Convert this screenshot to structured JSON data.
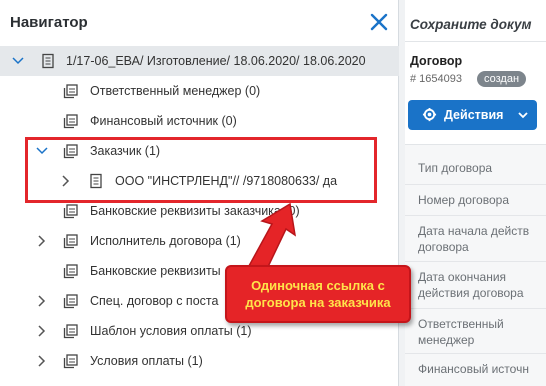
{
  "navigator": {
    "title": "Навигатор",
    "tree": [
      {
        "label": "1/17-06_ЕВА/ Изготовление/ 18.06.2020/ 18.06.2020",
        "expander": "down",
        "icon": "document-icon"
      },
      {
        "label": "Ответственный менеджер (0)",
        "expander": "none",
        "icon": "link-card-icon"
      },
      {
        "label": "Финансовый источник (0)",
        "expander": "none",
        "icon": "link-card-icon"
      },
      {
        "label": "Заказчик (1)",
        "expander": "down",
        "icon": "link-card-icon"
      },
      {
        "label": "ООО \"ИНСТРЛЕНД\"// /9718080633/ да",
        "expander": "right",
        "icon": "document-icon"
      },
      {
        "label": "Банковские реквизиты заказчика (0)",
        "expander": "none",
        "icon": "link-card-icon"
      },
      {
        "label": "Исполнитель договора (1)",
        "expander": "right",
        "icon": "link-card-icon"
      },
      {
        "label": "Банковские реквизиты",
        "expander": "none",
        "icon": "link-card-icon"
      },
      {
        "label": "Спец. договор с поста",
        "expander": "right",
        "icon": "link-card-icon"
      },
      {
        "label": "Шаблон условия оплаты (1)",
        "expander": "right",
        "icon": "link-card-icon"
      },
      {
        "label": "Условия оплаты (1)",
        "expander": "right",
        "icon": "link-card-icon"
      }
    ]
  },
  "details": {
    "title": "Сохраните докум",
    "doc_type": "Договор",
    "doc_number": "# 1654093",
    "status": "создан",
    "actions_label": "Действия",
    "fields": [
      [
        "Тип договора"
      ],
      [
        "Номер договора"
      ],
      [
        "Дата начала действ",
        "договора"
      ],
      [
        "Дата окончания",
        "действия договора"
      ],
      [
        "Ответственный",
        "менеджер"
      ],
      [
        "Финансовый источн"
      ]
    ]
  },
  "annotation": {
    "callout_text": "Одиночная ссылка с договора на заказчика"
  },
  "colors": {
    "accent": "#1a73c8",
    "highlight": "#e3262b",
    "callout_bg": "#e52427",
    "callout_text": "#ffe34a",
    "badge": "#7d858c"
  }
}
